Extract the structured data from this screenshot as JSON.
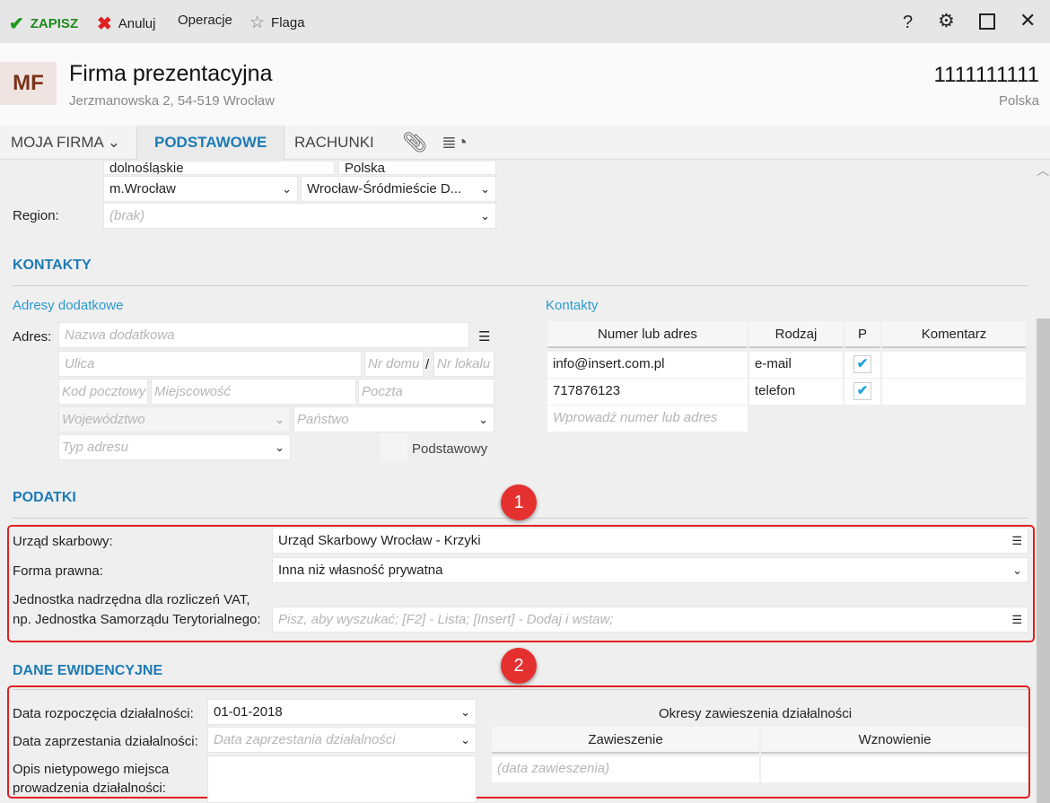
{
  "toolbar": {
    "save": "ZAPISZ",
    "cancel": "Anuluj",
    "operations": "Operacje",
    "flag": "Flaga",
    "help": "?"
  },
  "header": {
    "avatar": "MF",
    "title": "Firma prezentacyjna",
    "address": "Jerzmanowska 2, 54-519 Wrocław",
    "nip": "1111111111",
    "country": "Polska"
  },
  "tabs": {
    "my_company": "MOJA FIRMA",
    "basic": "PODSTAWOWE",
    "accounts": "RACHUNKI"
  },
  "address": {
    "voivodeship": "dolnośląskie",
    "country": "Polska",
    "county": "m.Wrocław",
    "district": "Wrocław-Śródmieście   D...",
    "region_label": "Region:",
    "region_placeholder": "(brak)"
  },
  "contacts": {
    "title": "KONTAKTY",
    "extra_title": "Adresy dodatkowe",
    "address_label": "Adres:",
    "ph": {
      "name": "Nazwa dodatkowa",
      "street": "Ulica",
      "house": "Nr domu",
      "sep": "/",
      "flat": "Nr lokalu",
      "zip": "Kod pocztowy",
      "city": "Miejscowość",
      "post": "Poczta",
      "voiv": "Województwo",
      "country": "Państwo",
      "type": "Typ adresu"
    },
    "primary_label": "Podstawowy",
    "list_title": "Kontakty",
    "columns": [
      "Numer lub adres",
      "Rodzaj",
      "P",
      "Komentarz"
    ],
    "rows": [
      {
        "value": "info@insert.com.pl",
        "kind": "e-mail",
        "primary": true,
        "comment": ""
      },
      {
        "value": "717876123",
        "kind": "telefon",
        "primary": true,
        "comment": ""
      }
    ],
    "new_placeholder": "Wprowadź numer lub adres"
  },
  "taxes": {
    "title": "PODATKI",
    "office_label": "Urząd skarbowy:",
    "office": "Urząd Skarbowy Wrocław - Krzyki",
    "form_label": "Forma prawna:",
    "form": "Inna niż własność prywatna",
    "parent_label_1": "Jednostka nadrzędna dla rozliczeń VAT,",
    "parent_label_2": "np. Jednostka Samorządu Terytorialnego:",
    "parent_placeholder": "Pisz, aby wyszukać; [F2] - Lista; [Insert] - Dodaj i wstaw;"
  },
  "registry": {
    "title": "DANE EWIDENCYJNE",
    "start_label": "Data rozpoczęcia działalności:",
    "start": "01-01-2018",
    "end_label": "Data zaprzestania działalności:",
    "end_placeholder": "Data zaprzestania działalności",
    "place_label_1": "Opis nietypowego miejsca",
    "place_label_2": "prowadzenia działalności:",
    "suspend_title": "Okresy zawieszenia działalności",
    "suspend_cols": [
      "Zawieszenie",
      "Wznowienie"
    ],
    "suspend_placeholder": "(data zawieszenia)"
  },
  "annotations": [
    "1",
    "2"
  ]
}
